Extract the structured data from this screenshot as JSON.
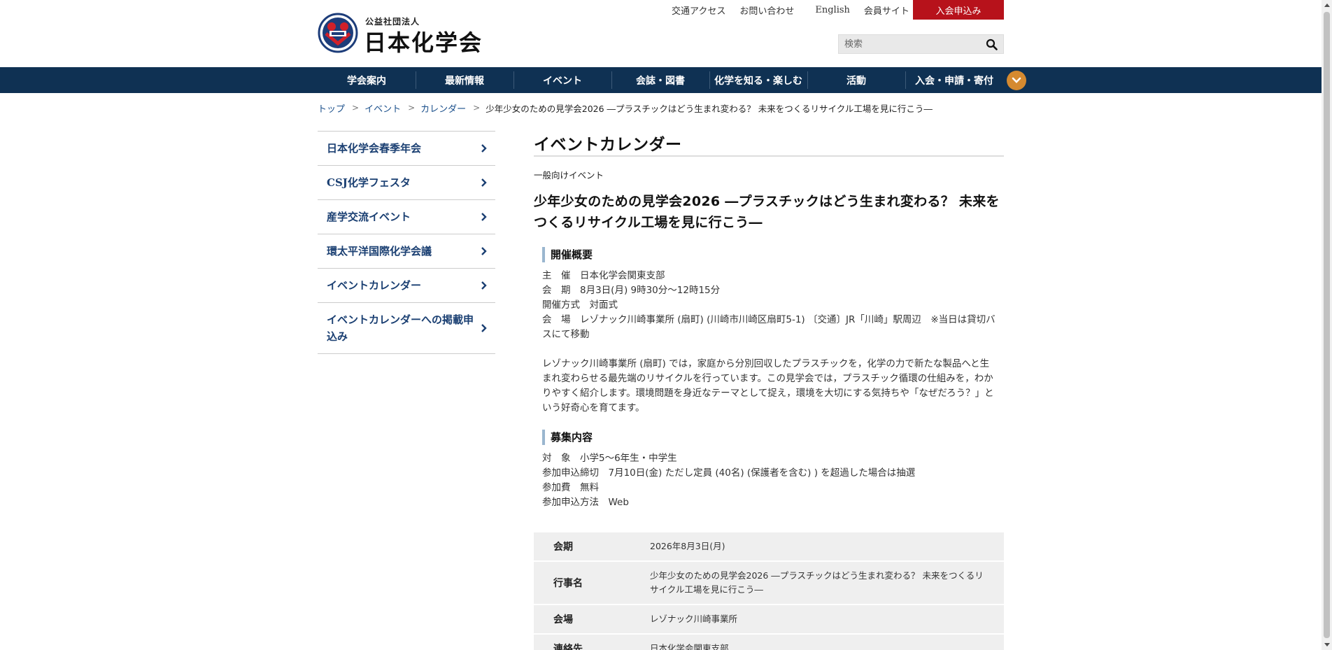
{
  "header": {
    "logo_small": "公益社団法人",
    "logo_big": "日本化学会",
    "util_links": [
      "交通アクセス",
      "お問い合わせ",
      "English",
      "会員サイト"
    ],
    "join_label": "入会申込み",
    "search_placeholder": "検索"
  },
  "nav": {
    "items": [
      "学会案内",
      "最新情報",
      "イベント",
      "会誌・図書",
      "化学を知る・楽しむ",
      "活動",
      "入会・申請・寄付"
    ]
  },
  "breadcrumb": {
    "items": [
      "トップ",
      "イベント",
      "カレンダー"
    ],
    "current": "少年少女のための見学会2026 ―プラスチックはどう生まれ変わる？ 未来をつくるリサイクル工場を見に行こう―"
  },
  "sidebar": {
    "items": [
      "日本化学会春季年会",
      "CSJ化学フェスタ",
      "産学交流イベント",
      "環太平洋国際化学会議",
      "イベントカレンダー",
      "イベントカレンダーへの掲載申込み"
    ]
  },
  "main": {
    "title": "イベントカレンダー",
    "category": "一般向けイベント",
    "event_title": "少年少女のための見学会2026 ―プラスチックはどう生まれ変わる？ 未来をつくるリサイクル工場を見に行こう―",
    "section1_head": "開催概要",
    "info1": [
      "主　催　日本化学会関東支部",
      "会　期　8月3日(月) 9時30分～12時15分",
      "開催方式　対面式",
      "会　場　レゾナック川崎事業所 (扇町) (川崎市川崎区扇町5-1) 〔交通〕JR「川崎」駅周辺　※当日は貸切バスにて移動"
    ],
    "description": "レゾナック川崎事業所 (扇町) では，家庭から分別回収したプラスチックを，化学の力で新たな製品へと生まれ変わらせる最先端のリサイクルを行っています。この見学会では，プラスチック循環の仕組みを，わかりやすく紹介します。環境問題を身近なテーマとして捉え，環境を大切にする気持ちや「なぜだろう？」という好奇心を育てます。",
    "section2_head": "募集内容",
    "info2": [
      "対　象　小学5～6年生・中学生",
      "参加申込締切　7月10日(金) ただし定員 (40名) (保護者を含む) ) を超過した場合は抽選",
      "参加費　無料",
      "参加申込方法　Web"
    ],
    "table": [
      {
        "key": "会期",
        "value": "2026年8月3日(月)"
      },
      {
        "key": "行事名",
        "value": "少年少女のための見学会2026 ―プラスチックはどう生まれ変わる？ 未来をつくるリサイクル工場を見に行こう―"
      },
      {
        "key": "会場",
        "value": "レゾナック川崎事業所"
      },
      {
        "key": "連絡先",
        "value": "日本化学会関東支部"
      }
    ]
  },
  "colors": {
    "nav_bg": "#0f3153",
    "join_bg": "#b7121b",
    "accent_orange": "#d58a30",
    "link_blue": "#1a4f8b"
  }
}
